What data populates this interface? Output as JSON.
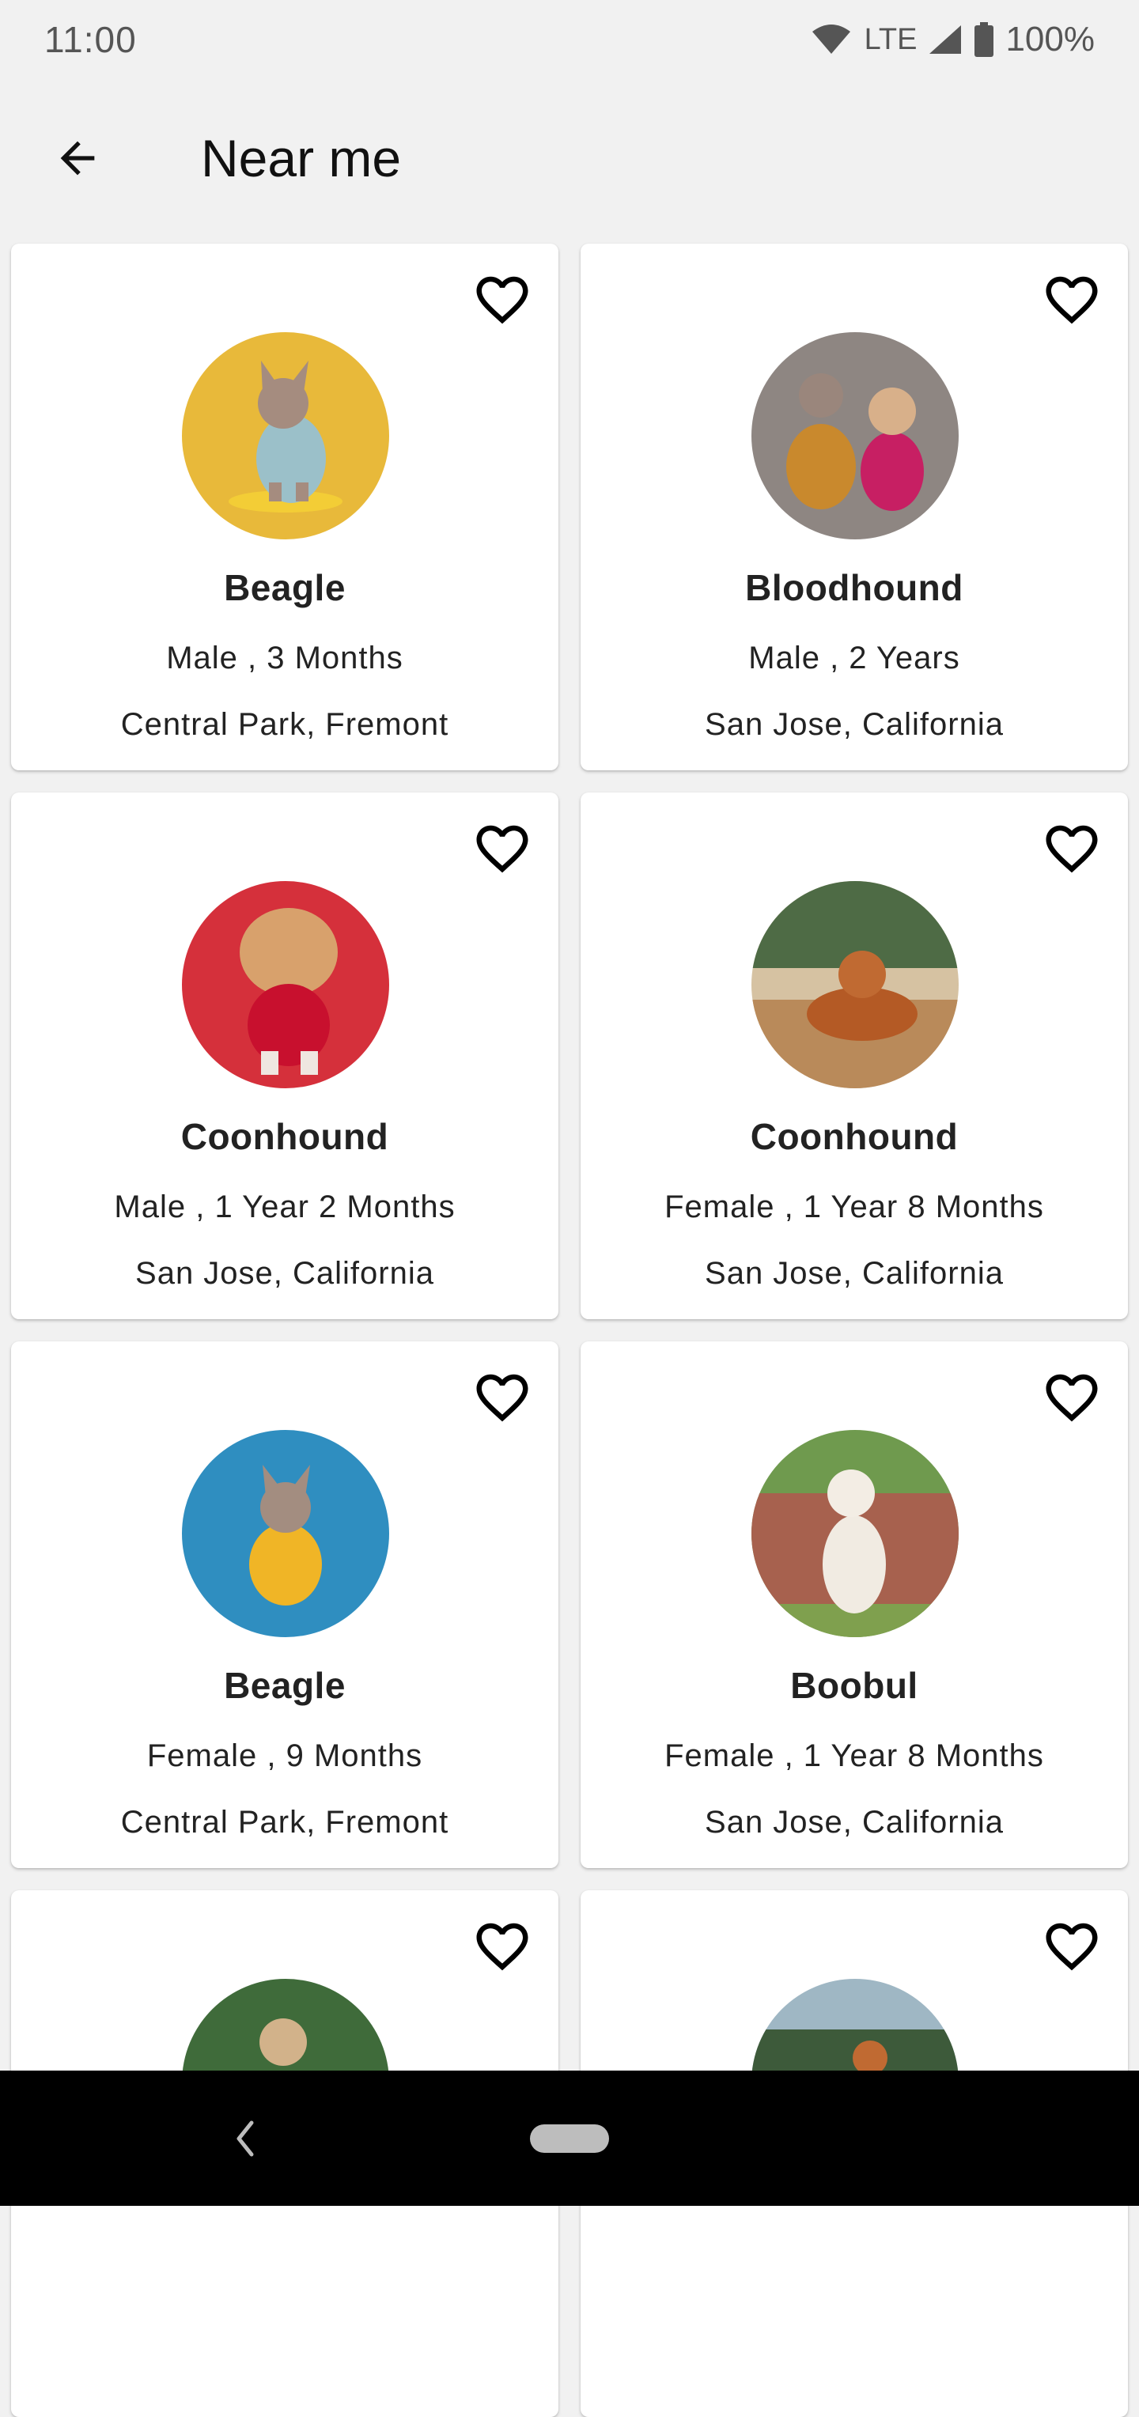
{
  "status_bar": {
    "time": "11:00",
    "network": "LTE",
    "battery": "100%"
  },
  "app_bar": {
    "title": "Near me",
    "back_icon": "arrow-left-icon"
  },
  "pets": [
    {
      "name": "Beagle",
      "meta": "Male , 3 Months",
      "location": "Central Park, Fremont",
      "photo_bg": "#e8b93a",
      "photo": "french-bulldog-yellow"
    },
    {
      "name": "Bloodhound",
      "meta": "Male , 2 Years",
      "location": "San Jose, California",
      "photo_bg": "#8e8682",
      "photo": "two-dogs-gray"
    },
    {
      "name": "Coonhound",
      "meta": "Male , 1 Year 2 Months",
      "location": "San Jose, California",
      "photo_bg": "#d5303b",
      "photo": "shih-tzu-red"
    },
    {
      "name": "Coonhound",
      "meta": "Female , 1 Year 8 Months",
      "location": "San Jose, California",
      "photo_bg": "#b98a5a",
      "photo": "retriever-sand"
    },
    {
      "name": "Beagle",
      "meta": "Female , 9 Months",
      "location": "Central Park, Fremont",
      "photo_bg": "#2f8ec0",
      "photo": "french-bulldog-blue"
    },
    {
      "name": "Boobul",
      "meta": "Female , 1 Year 8 Months",
      "location": "San Jose, California",
      "photo_bg": "#a7614e",
      "photo": "akita-brick-wall"
    },
    {
      "name": "",
      "meta": "",
      "location": "",
      "photo_bg": "#3f6b3a",
      "photo": "dog-forest"
    },
    {
      "name": "",
      "meta": "",
      "location": "",
      "photo_bg": "#9fb7c4",
      "photo": "dog-field"
    }
  ],
  "icons": {
    "favorite": "heart-outline-icon",
    "nav_back": "nav-back-icon",
    "nav_home": "nav-home-pill"
  }
}
